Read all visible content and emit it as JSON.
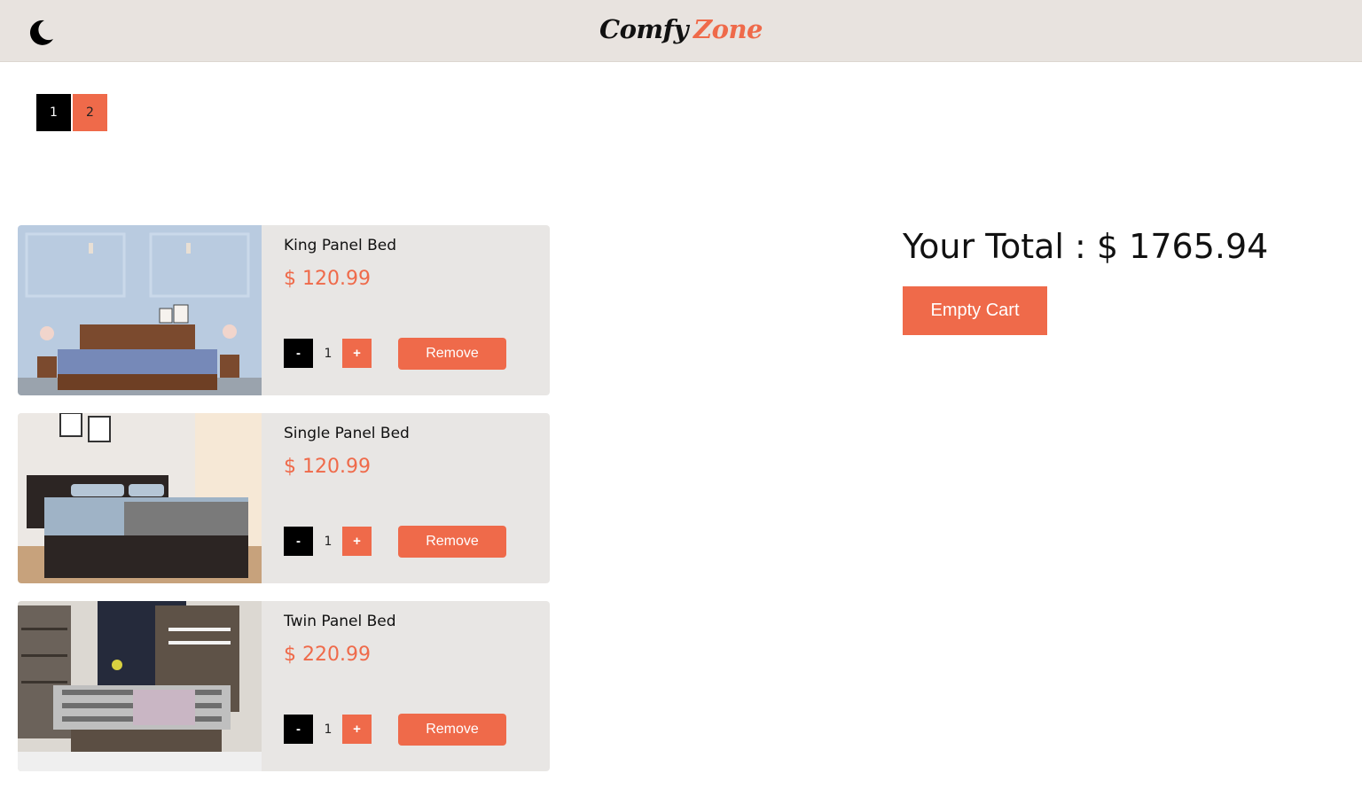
{
  "header": {
    "brand_part1": "Comfy",
    "brand_part2": "Zone",
    "theme_toggle_icon": "moon-icon",
    "accent_color": "#ef6a4a"
  },
  "pagination": {
    "pages": [
      "1",
      "2"
    ],
    "active": "1"
  },
  "cart": {
    "items": [
      {
        "name": "King Panel Bed",
        "price": "$ 120.99",
        "quantity": "1",
        "minus": "-",
        "plus": "+",
        "remove": "Remove"
      },
      {
        "name": "Single Panel Bed",
        "price": "$ 120.99",
        "quantity": "1",
        "minus": "-",
        "plus": "+",
        "remove": "Remove"
      },
      {
        "name": "Twin Panel Bed",
        "price": "$ 220.99",
        "quantity": "1",
        "minus": "-",
        "plus": "+",
        "remove": "Remove"
      }
    ],
    "total_text": "Your Total : $ 1765.94",
    "empty_cart_label": "Empty Cart"
  }
}
